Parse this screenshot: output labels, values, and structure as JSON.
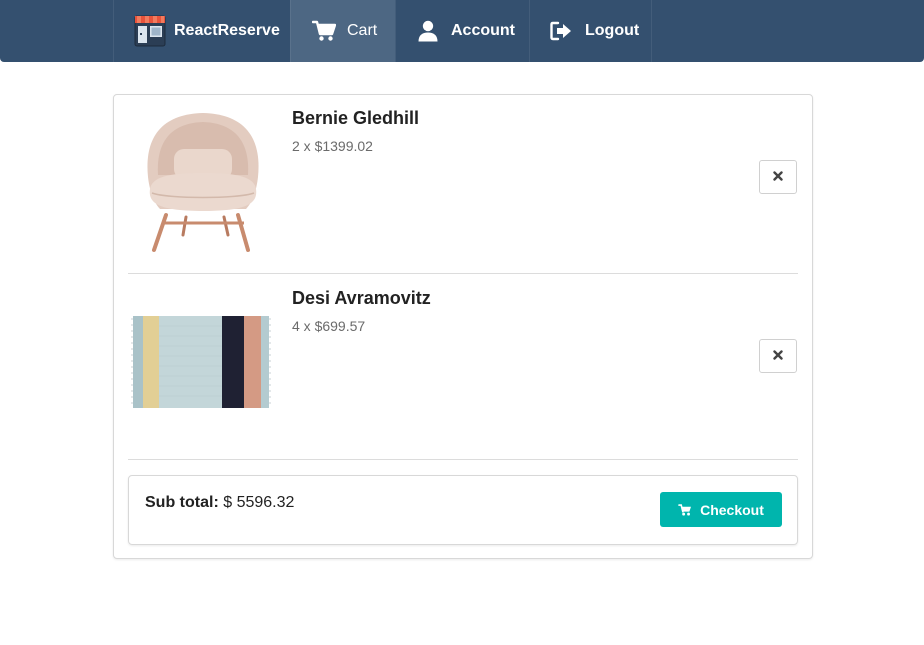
{
  "nav": {
    "brand": {
      "label": "ReactReserve",
      "icon": "shop-logo-icon"
    },
    "items": [
      {
        "label": "Cart",
        "icon": "cart-icon",
        "active": true
      },
      {
        "label": "Account",
        "icon": "user-icon",
        "active": false
      },
      {
        "label": "Logout",
        "icon": "sign-out-icon",
        "active": false
      }
    ]
  },
  "cart": {
    "items": [
      {
        "name": "Bernie Gledhill",
        "quantity_price": "2 x $1399.02",
        "image": "lounge-chair-photo",
        "remove_icon": "close-icon"
      },
      {
        "name": "Desi Avramovitz",
        "quantity_price": "4 x $699.57",
        "image": "striped-rug-photo",
        "remove_icon": "close-icon"
      }
    ],
    "summary": {
      "subtotal_label": "Sub total:",
      "subtotal_value": "$ 5596.32",
      "checkout_label": "Checkout",
      "checkout_icon": "cart-icon"
    }
  },
  "colors": {
    "navbar": "#34506f",
    "navbar_active": "#4d6783",
    "checkout_button": "#00b5ad"
  }
}
